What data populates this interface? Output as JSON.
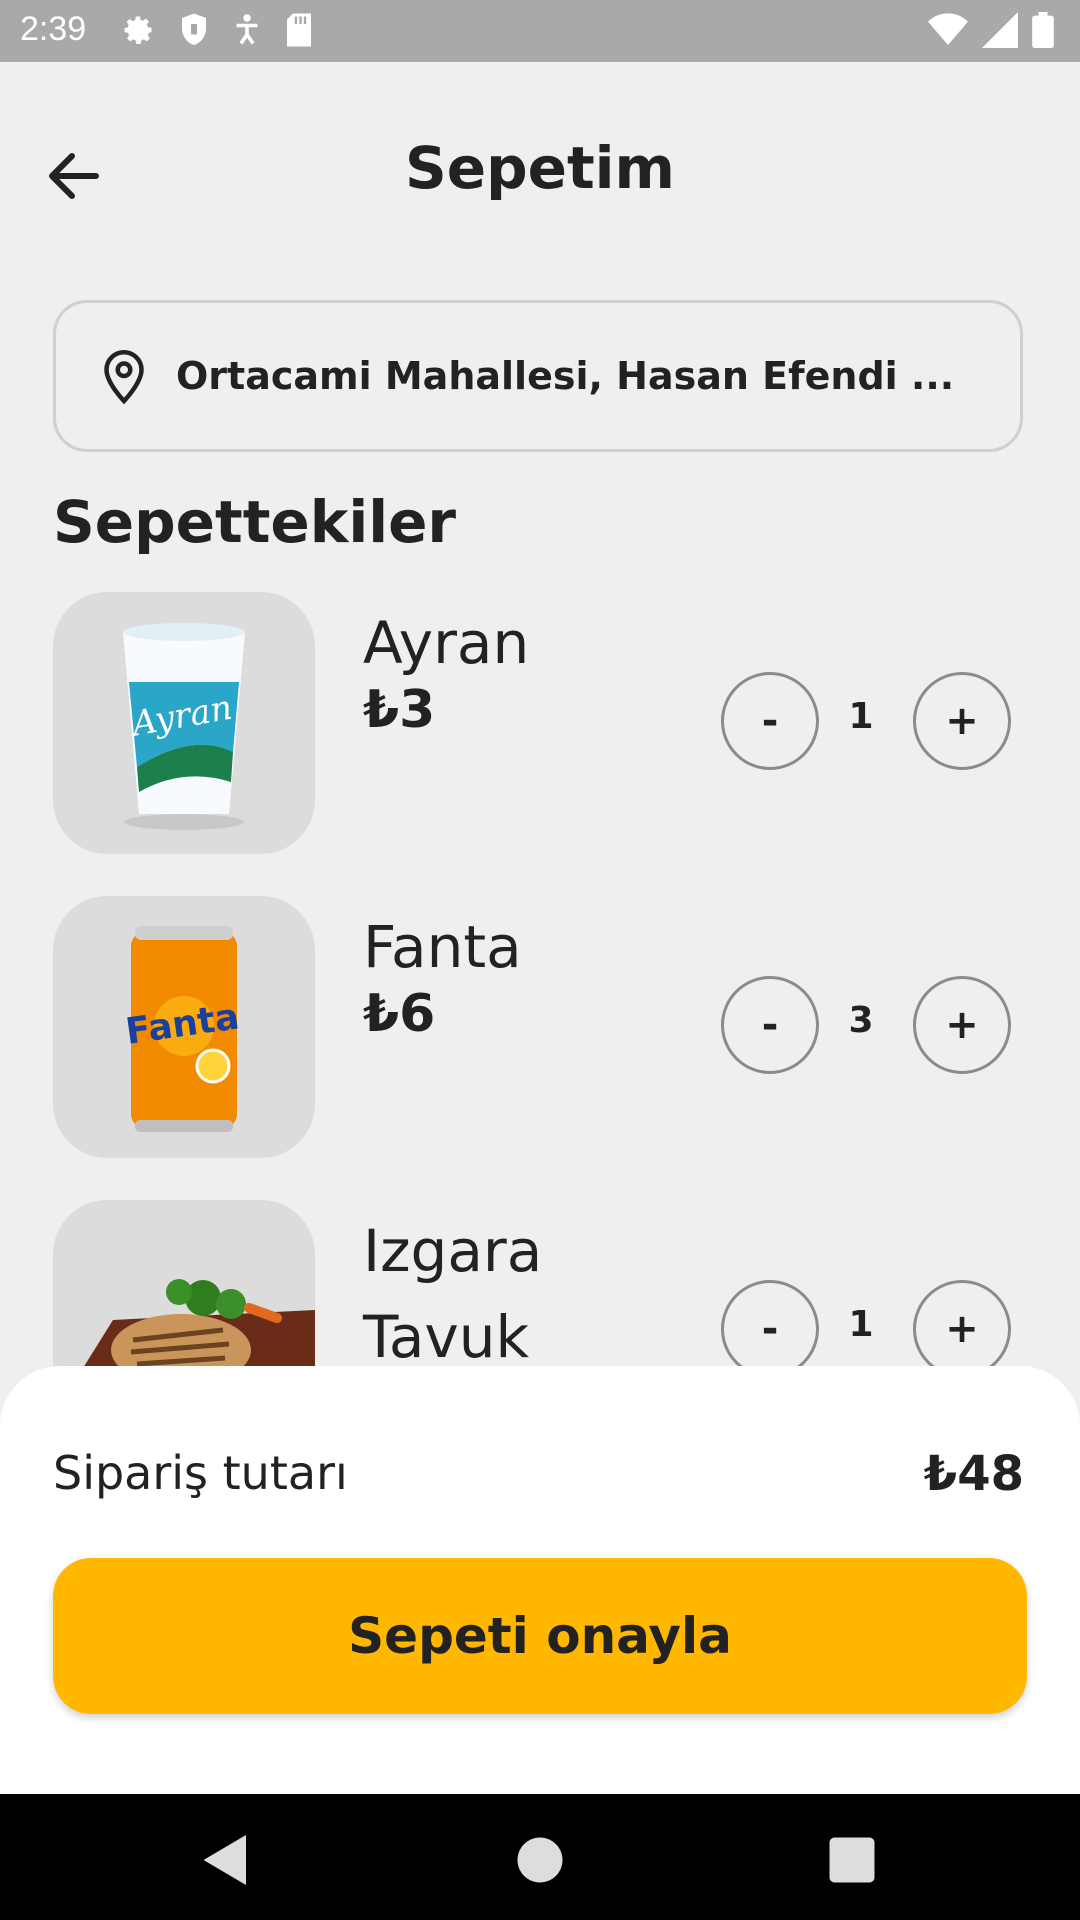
{
  "status_bar": {
    "time": "2:39",
    "icons_left": [
      "gear-icon",
      "shield-icon",
      "accessibility-icon",
      "sd-card-icon"
    ],
    "icons_right": [
      "wifi-icon",
      "signal-icon",
      "battery-icon"
    ]
  },
  "header": {
    "title": "Sepetim",
    "back_icon": "arrow-left-icon"
  },
  "address": {
    "text": "Ortacami Mahallesi, Hasan Efendi ...",
    "icon": "location-pin-icon"
  },
  "section": {
    "title": "Sepettekiler"
  },
  "cart": {
    "items": [
      {
        "name": "Ayran",
        "price": "₺3",
        "quantity": "1",
        "minus_label": "-",
        "plus_label": "+"
      },
      {
        "name": "Fanta",
        "price": "₺6",
        "quantity": "3",
        "minus_label": "-",
        "plus_label": "+"
      },
      {
        "name": "Izgara Tavuk",
        "price": "",
        "quantity": "1",
        "minus_label": "-",
        "plus_label": "+"
      }
    ]
  },
  "summary": {
    "total_label": "Sipariş tutarı",
    "total_value": "₺48"
  },
  "confirm": {
    "label": "Sepeti onayla"
  },
  "colors": {
    "accent": "#ffb700",
    "background": "#efefef",
    "sheet": "#ffffff"
  },
  "nav": {
    "icons": [
      "back-triangle-icon",
      "home-circle-icon",
      "recents-square-icon"
    ]
  }
}
